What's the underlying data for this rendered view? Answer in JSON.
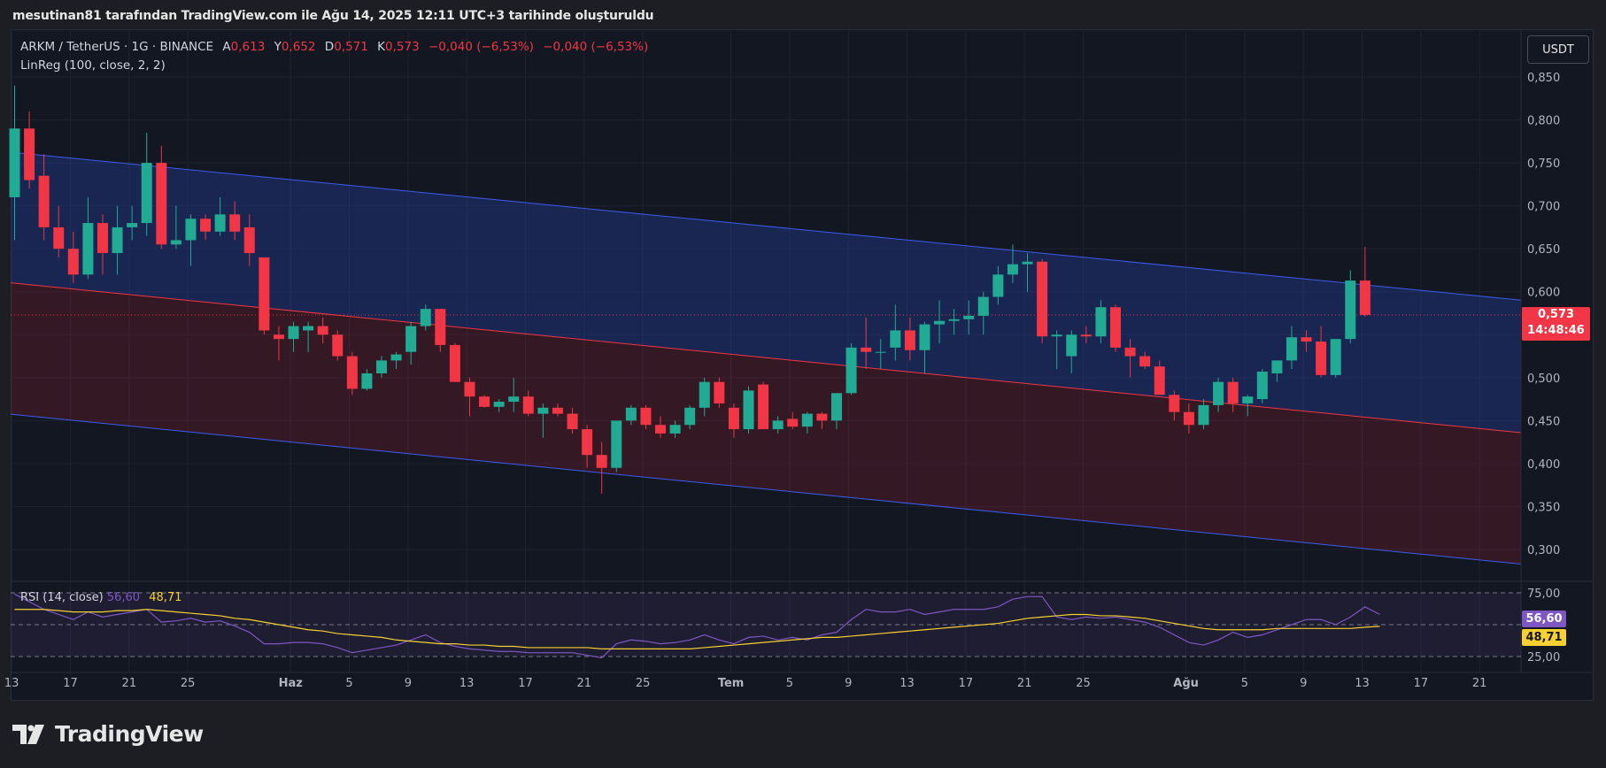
{
  "caption": "mesutinan81 tarafından TradingView.com ile Ağu 14, 2025 12:11 UTC+3 tarihinde oluşturuldu",
  "symbol_line": {
    "symbol": "ARKM / TetherUS · 1G · BINANCE",
    "open_label": "A",
    "open": "0,613",
    "high_label": "Y",
    "high": "0,652",
    "low_label": "D",
    "low": "0,571",
    "close_label": "K",
    "close": "0,573",
    "change": "−0,040 (−6,53%)",
    "change2": "−0,040 (−6,53%)"
  },
  "indicator_label": "LinReg (100, close, 2, 2)",
  "currency_button": "USDT",
  "last_price": {
    "value": "0,573",
    "countdown": "14:48:46"
  },
  "rsi": {
    "label": "RSI (14, close)",
    "value": "56,60",
    "ma_value": "48,71"
  },
  "brand": "TradingView",
  "colors": {
    "up": "#22ab94",
    "down": "#f23645",
    "channel_upper": "#3d5cf0",
    "channel_mid": "#f23645",
    "rsi_line": "#7e57c2",
    "rsi_ma": "#f7d031",
    "background": "#131722"
  },
  "chart_data": {
    "type": "candlestick",
    "y_axis": {
      "min": 0.3,
      "max": 0.85,
      "ticks": [
        "0,850",
        "0,800",
        "0,750",
        "0,700",
        "0,650",
        "0,600",
        "0,550",
        "0,500",
        "0,450",
        "0,400",
        "0,350",
        "0,300"
      ]
    },
    "x_axis_labels": [
      {
        "i": -0.2,
        "label": "13"
      },
      {
        "i": 3.8,
        "label": "17"
      },
      {
        "i": 7.8,
        "label": "21"
      },
      {
        "i": 11.8,
        "label": "25"
      },
      {
        "i": 18.8,
        "label": "Haz"
      },
      {
        "i": 22.8,
        "label": "5"
      },
      {
        "i": 26.8,
        "label": "9"
      },
      {
        "i": 30.8,
        "label": "13"
      },
      {
        "i": 34.8,
        "label": "17"
      },
      {
        "i": 38.8,
        "label": "21"
      },
      {
        "i": 42.8,
        "label": "25"
      },
      {
        "i": 48.8,
        "label": "Tem"
      },
      {
        "i": 52.8,
        "label": "5"
      },
      {
        "i": 56.8,
        "label": "9"
      },
      {
        "i": 60.8,
        "label": "13"
      },
      {
        "i": 64.8,
        "label": "17"
      },
      {
        "i": 68.8,
        "label": "21"
      },
      {
        "i": 72.8,
        "label": "25"
      },
      {
        "i": 79.8,
        "label": "Ağu"
      },
      {
        "i": 83.8,
        "label": "5"
      },
      {
        "i": 87.8,
        "label": "9"
      },
      {
        "i": 91.8,
        "label": "13"
      },
      {
        "i": 95.8,
        "label": "17"
      },
      {
        "i": 99.8,
        "label": "21"
      }
    ],
    "candles": [
      [
        0.71,
        0.84,
        0.66,
        0.79
      ],
      [
        0.79,
        0.81,
        0.72,
        0.73
      ],
      [
        0.735,
        0.76,
        0.66,
        0.675
      ],
      [
        0.675,
        0.7,
        0.64,
        0.65
      ],
      [
        0.65,
        0.67,
        0.61,
        0.62
      ],
      [
        0.62,
        0.71,
        0.615,
        0.68
      ],
      [
        0.68,
        0.69,
        0.62,
        0.645
      ],
      [
        0.645,
        0.7,
        0.62,
        0.675
      ],
      [
        0.675,
        0.7,
        0.66,
        0.68
      ],
      [
        0.68,
        0.785,
        0.665,
        0.75
      ],
      [
        0.75,
        0.77,
        0.65,
        0.655
      ],
      [
        0.655,
        0.7,
        0.65,
        0.66
      ],
      [
        0.66,
        0.69,
        0.63,
        0.685
      ],
      [
        0.685,
        0.69,
        0.66,
        0.67
      ],
      [
        0.67,
        0.71,
        0.665,
        0.69
      ],
      [
        0.69,
        0.705,
        0.66,
        0.67
      ],
      [
        0.675,
        0.69,
        0.63,
        0.645
      ],
      [
        0.64,
        0.64,
        0.55,
        0.555
      ],
      [
        0.55,
        0.56,
        0.52,
        0.545
      ],
      [
        0.545,
        0.565,
        0.53,
        0.56
      ],
      [
        0.555,
        0.565,
        0.53,
        0.56
      ],
      [
        0.56,
        0.57,
        0.54,
        0.55
      ],
      [
        0.55,
        0.555,
        0.52,
        0.525
      ],
      [
        0.525,
        0.53,
        0.48,
        0.487
      ],
      [
        0.487,
        0.51,
        0.485,
        0.505
      ],
      [
        0.505,
        0.525,
        0.5,
        0.52
      ],
      [
        0.52,
        0.53,
        0.51,
        0.527
      ],
      [
        0.53,
        0.565,
        0.515,
        0.56
      ],
      [
        0.56,
        0.585,
        0.555,
        0.58
      ],
      [
        0.58,
        0.58,
        0.53,
        0.538
      ],
      [
        0.538,
        0.54,
        0.495,
        0.495
      ],
      [
        0.495,
        0.5,
        0.455,
        0.478
      ],
      [
        0.478,
        0.48,
        0.465,
        0.466
      ],
      [
        0.466,
        0.475,
        0.46,
        0.472
      ],
      [
        0.472,
        0.5,
        0.46,
        0.478
      ],
      [
        0.478,
        0.485,
        0.455,
        0.458
      ],
      [
        0.458,
        0.47,
        0.43,
        0.465
      ],
      [
        0.465,
        0.47,
        0.455,
        0.458
      ],
      [
        0.458,
        0.465,
        0.435,
        0.44
      ],
      [
        0.44,
        0.445,
        0.395,
        0.41
      ],
      [
        0.41,
        0.425,
        0.365,
        0.395
      ],
      [
        0.395,
        0.445,
        0.39,
        0.45
      ],
      [
        0.45,
        0.468,
        0.445,
        0.465
      ],
      [
        0.465,
        0.468,
        0.44,
        0.445
      ],
      [
        0.445,
        0.455,
        0.43,
        0.435
      ],
      [
        0.435,
        0.45,
        0.43,
        0.445
      ],
      [
        0.445,
        0.468,
        0.44,
        0.465
      ],
      [
        0.465,
        0.5,
        0.455,
        0.495
      ],
      [
        0.495,
        0.5,
        0.465,
        0.47
      ],
      [
        0.465,
        0.47,
        0.43,
        0.44
      ],
      [
        0.44,
        0.49,
        0.435,
        0.485
      ],
      [
        0.492,
        0.495,
        0.44,
        0.44
      ],
      [
        0.44,
        0.455,
        0.435,
        0.45
      ],
      [
        0.452,
        0.46,
        0.44,
        0.443
      ],
      [
        0.443,
        0.46,
        0.435,
        0.458
      ],
      [
        0.458,
        0.46,
        0.44,
        0.45
      ],
      [
        0.45,
        0.475,
        0.44,
        0.482
      ],
      [
        0.482,
        0.54,
        0.48,
        0.535
      ],
      [
        0.535,
        0.57,
        0.51,
        0.53
      ],
      [
        0.53,
        0.545,
        0.51,
        0.53
      ],
      [
        0.535,
        0.585,
        0.52,
        0.555
      ],
      [
        0.555,
        0.57,
        0.52,
        0.532
      ],
      [
        0.532,
        0.565,
        0.505,
        0.562
      ],
      [
        0.562,
        0.59,
        0.54,
        0.566
      ],
      [
        0.566,
        0.58,
        0.55,
        0.568
      ],
      [
        0.568,
        0.59,
        0.55,
        0.572
      ],
      [
        0.572,
        0.6,
        0.55,
        0.594
      ],
      [
        0.594,
        0.63,
        0.585,
        0.62
      ],
      [
        0.62,
        0.655,
        0.61,
        0.632
      ],
      [
        0.632,
        0.645,
        0.6,
        0.635
      ],
      [
        0.635,
        0.638,
        0.54,
        0.548
      ],
      [
        0.548,
        0.555,
        0.51,
        0.55
      ],
      [
        0.525,
        0.555,
        0.505,
        0.55
      ],
      [
        0.55,
        0.56,
        0.54,
        0.548
      ],
      [
        0.548,
        0.59,
        0.54,
        0.582
      ],
      [
        0.582,
        0.585,
        0.53,
        0.535
      ],
      [
        0.535,
        0.545,
        0.5,
        0.525
      ],
      [
        0.525,
        0.53,
        0.51,
        0.513
      ],
      [
        0.513,
        0.52,
        0.48,
        0.48
      ],
      [
        0.48,
        0.485,
        0.45,
        0.46
      ],
      [
        0.46,
        0.47,
        0.435,
        0.445
      ],
      [
        0.445,
        0.475,
        0.44,
        0.468
      ],
      [
        0.468,
        0.5,
        0.46,
        0.495
      ],
      [
        0.495,
        0.5,
        0.46,
        0.47
      ],
      [
        0.47,
        0.48,
        0.455,
        0.478
      ],
      [
        0.475,
        0.51,
        0.47,
        0.507
      ],
      [
        0.505,
        0.52,
        0.495,
        0.52
      ],
      [
        0.52,
        0.56,
        0.51,
        0.547
      ],
      [
        0.547,
        0.555,
        0.53,
        0.542
      ],
      [
        0.542,
        0.56,
        0.5,
        0.503
      ],
      [
        0.503,
        0.545,
        0.5,
        0.545
      ],
      [
        0.545,
        0.625,
        0.54,
        0.613
      ],
      [
        0.613,
        0.652,
        0.571,
        0.573
      ]
    ],
    "regression_channel": {
      "upper": [
        0.762,
        0.608
      ],
      "middle": [
        0.61,
        0.454
      ],
      "lower": [
        0.457,
        0.301
      ]
    },
    "rsi_series": {
      "y_axis": {
        "min": 25,
        "max": 75,
        "ticks": [
          "75,00",
          "25,00"
        ],
        "mid": 50
      },
      "rsi": [
        74,
        68,
        62,
        58,
        54,
        60,
        56,
        58,
        60,
        62,
        52,
        53,
        55,
        52,
        53,
        49,
        44,
        35,
        35,
        36,
        36,
        35,
        32,
        28,
        30,
        32,
        34,
        38,
        42,
        36,
        33,
        31,
        30,
        29,
        29,
        28,
        28,
        28,
        28,
        26,
        24,
        35,
        38,
        37,
        35,
        36,
        38,
        42,
        38,
        35,
        40,
        41,
        38,
        40,
        38,
        42,
        44,
        54,
        62,
        60,
        60,
        62,
        58,
        60,
        62,
        62,
        62,
        64,
        70,
        72,
        72,
        56,
        54,
        56,
        55,
        56,
        54,
        52,
        48,
        42,
        36,
        34,
        38,
        44,
        40,
        42,
        46,
        50,
        54,
        54,
        50,
        56,
        64,
        58
      ],
      "ma": [
        62,
        62,
        62,
        61,
        60,
        60,
        60,
        61,
        61,
        62,
        61,
        60,
        59,
        58,
        57,
        55,
        54,
        52,
        50,
        48,
        46,
        45,
        43,
        42,
        41,
        40,
        38,
        37,
        36,
        35,
        35,
        34,
        34,
        33,
        33,
        32,
        32,
        32,
        32,
        32,
        31,
        31,
        31,
        31,
        31,
        31,
        31,
        32,
        33,
        34,
        35,
        36,
        37,
        38,
        39,
        40,
        40,
        41,
        42,
        43,
        44,
        45,
        46,
        47,
        48,
        49,
        50,
        51,
        53,
        55,
        56,
        57,
        58,
        58,
        57,
        57,
        56,
        55,
        53,
        51,
        49,
        47,
        46,
        46,
        46,
        46,
        47,
        47,
        47,
        47,
        47,
        47,
        48,
        48.71
      ]
    }
  }
}
